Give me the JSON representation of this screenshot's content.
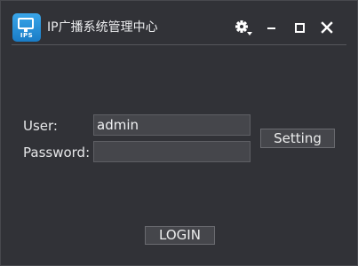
{
  "window": {
    "title": "IP广播系统管理中心",
    "app_icon_text": "IPS",
    "controls": {
      "settings_icon": "gear-dropdown-icon",
      "minimize_icon": "minimize-icon",
      "maximize_icon": "maximize-icon",
      "close_icon": "close-icon"
    }
  },
  "login_form": {
    "user_label": "User:",
    "user_value": "admin",
    "password_label": "Password:",
    "password_value": "",
    "setting_button": "Setting",
    "login_button": "LOGIN"
  },
  "colors": {
    "background": "#313237",
    "field": "#45464b",
    "text": "#e6e7e9",
    "icon_blue": "#2a8fd8"
  }
}
